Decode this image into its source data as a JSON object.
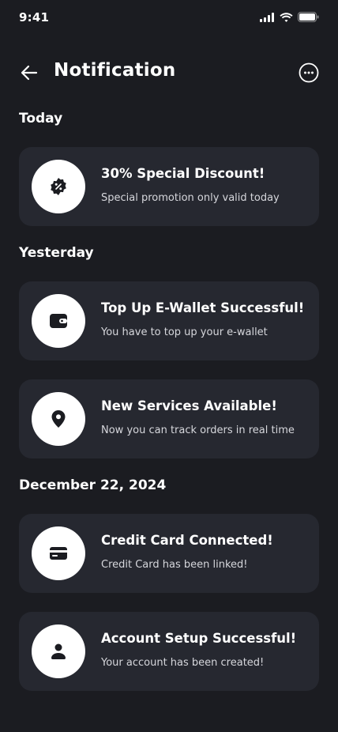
{
  "status": {
    "time": "9:41"
  },
  "header": {
    "title": "Notification"
  },
  "sections": [
    {
      "title": "Today"
    },
    {
      "title": "Yesterday"
    },
    {
      "title": "December 22, 2024"
    }
  ],
  "notifications": [
    {
      "icon": "discount-badge-icon",
      "title": "30% Special Discount!",
      "subtitle": "Special promotion only valid today"
    },
    {
      "icon": "wallet-icon",
      "title": "Top Up E-Wallet Successful!",
      "subtitle": "You have to top up your e-wallet"
    },
    {
      "icon": "location-pin-icon",
      "title": "New Services Available!",
      "subtitle": "Now you can track orders in real time"
    },
    {
      "icon": "credit-card-icon",
      "title": "Credit Card Connected!",
      "subtitle": "Credit Card has been linked!"
    },
    {
      "icon": "user-icon",
      "title": "Account Setup Successful!",
      "subtitle": "Your account has been created!"
    }
  ],
  "colors": {
    "background": "#1b1c21",
    "card": "#262830",
    "icon_bg": "#ffffff",
    "icon_fg": "#1b1c21"
  }
}
